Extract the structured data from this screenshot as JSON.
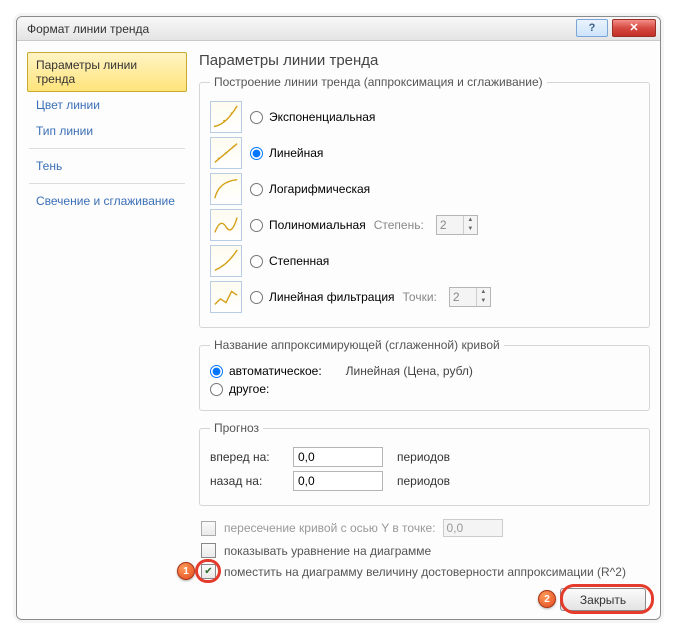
{
  "titlebar": {
    "title": "Формат линии тренда"
  },
  "sidebar": {
    "items": [
      {
        "label": "Параметры линии тренда",
        "selected": true
      },
      {
        "label": "Цвет линии"
      },
      {
        "label": "Тип линии"
      },
      {
        "label": "Тень"
      },
      {
        "label": "Свечение и сглаживание"
      }
    ]
  },
  "main": {
    "heading": "Параметры линии тренда",
    "trend_group": {
      "legend": "Построение линии тренда (аппроксимация и сглаживание)",
      "types": [
        {
          "label": "Экспоненциальная",
          "checked": false
        },
        {
          "label": "Линейная",
          "checked": true
        },
        {
          "label": "Логарифмическая",
          "checked": false
        },
        {
          "label": "Полиномиальная",
          "checked": false,
          "param_label": "Степень:",
          "param_value": "2",
          "param_enabled": false
        },
        {
          "label": "Степенная",
          "checked": false
        },
        {
          "label": "Линейная фильтрация",
          "checked": false,
          "param_label": "Точки:",
          "param_value": "2",
          "param_enabled": false
        }
      ]
    },
    "name_group": {
      "legend": "Название аппроксимирующей (сглаженной) кривой",
      "options": [
        {
          "label": "автоматическое:",
          "checked": true,
          "value": "Линейная (Цена, рубл)"
        },
        {
          "label": "другое:",
          "checked": false
        }
      ]
    },
    "forecast_group": {
      "legend": "Прогноз",
      "rows": [
        {
          "label": "вперед на:",
          "value": "0,0",
          "unit": "периодов"
        },
        {
          "label": "назад на:",
          "value": "0,0",
          "unit": "периодов"
        }
      ]
    },
    "checks": [
      {
        "label": "пересечение кривой с осью Y в точке:",
        "checked": false,
        "enabled": false,
        "value": "0,0"
      },
      {
        "label": "показывать уравнение на диаграмме",
        "checked": false,
        "enabled": true
      },
      {
        "label": "поместить на диаграмму величину достоверности аппроксимации (R^2)",
        "checked": true,
        "enabled": true
      }
    ]
  },
  "footer": {
    "close_label": "Закрыть"
  },
  "callouts": {
    "c1": "1",
    "c2": "2"
  }
}
